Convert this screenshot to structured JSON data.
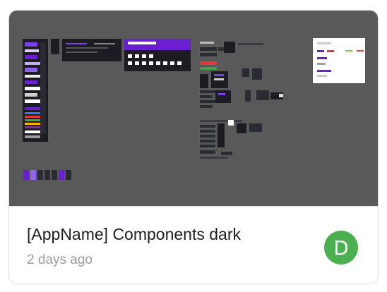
{
  "file": {
    "title": "[AppName] Components dark",
    "modified": "2 days ago"
  },
  "owner": {
    "initial": "D",
    "avatar_color": "#4caf50"
  },
  "thumbnail": {
    "canvas_color": "#595959",
    "accent_color": "#6a1fd1"
  }
}
